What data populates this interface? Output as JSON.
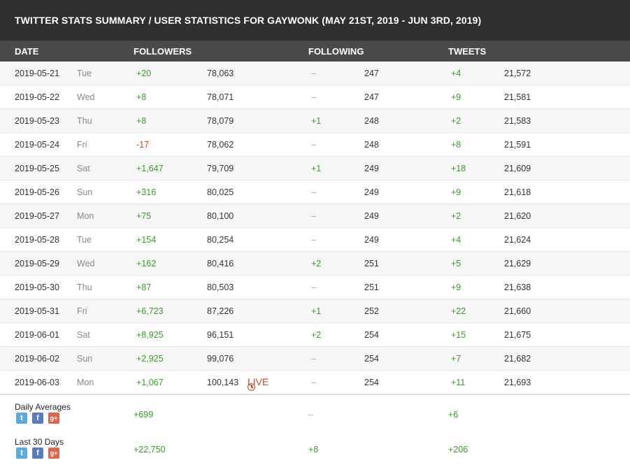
{
  "title": "TWITTER STATS SUMMARY / USER STATISTICS FOR GAYWONK (MAY 21ST, 2019 - JUN 3RD, 2019)",
  "headers": {
    "date": "DATE",
    "followers": "FOLLOWERS",
    "following": "FOLLOWING",
    "tweets": "TWEETS"
  },
  "rows": [
    {
      "date": "2019-05-21",
      "day": "Tue",
      "f_delta": "+20",
      "f_total": "78,063",
      "g_delta": "–",
      "g_total": "247",
      "t_delta": "+4",
      "t_total": "21,572"
    },
    {
      "date": "2019-05-22",
      "day": "Wed",
      "f_delta": "+8",
      "f_total": "78,071",
      "g_delta": "–",
      "g_total": "247",
      "t_delta": "+9",
      "t_total": "21,581"
    },
    {
      "date": "2019-05-23",
      "day": "Thu",
      "f_delta": "+8",
      "f_total": "78,079",
      "g_delta": "+1",
      "g_total": "248",
      "t_delta": "+2",
      "t_total": "21,583"
    },
    {
      "date": "2019-05-24",
      "day": "Fri",
      "f_delta": "-17",
      "f_total": "78,062",
      "g_delta": "–",
      "g_total": "248",
      "t_delta": "+8",
      "t_total": "21,591"
    },
    {
      "date": "2019-05-25",
      "day": "Sat",
      "f_delta": "+1,647",
      "f_total": "79,709",
      "g_delta": "+1",
      "g_total": "249",
      "t_delta": "+18",
      "t_total": "21,609"
    },
    {
      "date": "2019-05-26",
      "day": "Sun",
      "f_delta": "+316",
      "f_total": "80,025",
      "g_delta": "–",
      "g_total": "249",
      "t_delta": "+9",
      "t_total": "21,618"
    },
    {
      "date": "2019-05-27",
      "day": "Mon",
      "f_delta": "+75",
      "f_total": "80,100",
      "g_delta": "–",
      "g_total": "249",
      "t_delta": "+2",
      "t_total": "21,620"
    },
    {
      "date": "2019-05-28",
      "day": "Tue",
      "f_delta": "+154",
      "f_total": "80,254",
      "g_delta": "–",
      "g_total": "249",
      "t_delta": "+4",
      "t_total": "21,624"
    },
    {
      "date": "2019-05-29",
      "day": "Wed",
      "f_delta": "+162",
      "f_total": "80,416",
      "g_delta": "+2",
      "g_total": "251",
      "t_delta": "+5",
      "t_total": "21,629"
    },
    {
      "date": "2019-05-30",
      "day": "Thu",
      "f_delta": "+87",
      "f_total": "80,503",
      "g_delta": "–",
      "g_total": "251",
      "t_delta": "+9",
      "t_total": "21,638"
    },
    {
      "date": "2019-05-31",
      "day": "Fri",
      "f_delta": "+6,723",
      "f_total": "87,226",
      "g_delta": "+1",
      "g_total": "252",
      "t_delta": "+22",
      "t_total": "21,660"
    },
    {
      "date": "2019-06-01",
      "day": "Sat",
      "f_delta": "+8,925",
      "f_total": "96,151",
      "g_delta": "+2",
      "g_total": "254",
      "t_delta": "+15",
      "t_total": "21,675"
    },
    {
      "date": "2019-06-02",
      "day": "Sun",
      "f_delta": "+2,925",
      "f_total": "99,076",
      "g_delta": "–",
      "g_total": "254",
      "t_delta": "+7",
      "t_total": "21,682"
    },
    {
      "date": "2019-06-03",
      "day": "Mon",
      "f_delta": "+1,067",
      "f_total": "100,143",
      "live": "LIVE",
      "g_delta": "–",
      "g_total": "254",
      "t_delta": "+11",
      "t_total": "21,693"
    }
  ],
  "summary": [
    {
      "label": "Daily Averages",
      "followers": "+699",
      "following": "–",
      "tweets": "+6"
    },
    {
      "label": "Last 30 Days",
      "followers": "+22,750",
      "following": "+8",
      "tweets": "+206"
    }
  ],
  "share_icons": {
    "twitter": "t",
    "facebook": "f",
    "google_plus": "g+"
  },
  "colors": {
    "positive": "#3a9a2a",
    "negative": "#d0462d",
    "title_bg": "#2f2f2f",
    "header_bg": "#4a4a4a"
  }
}
